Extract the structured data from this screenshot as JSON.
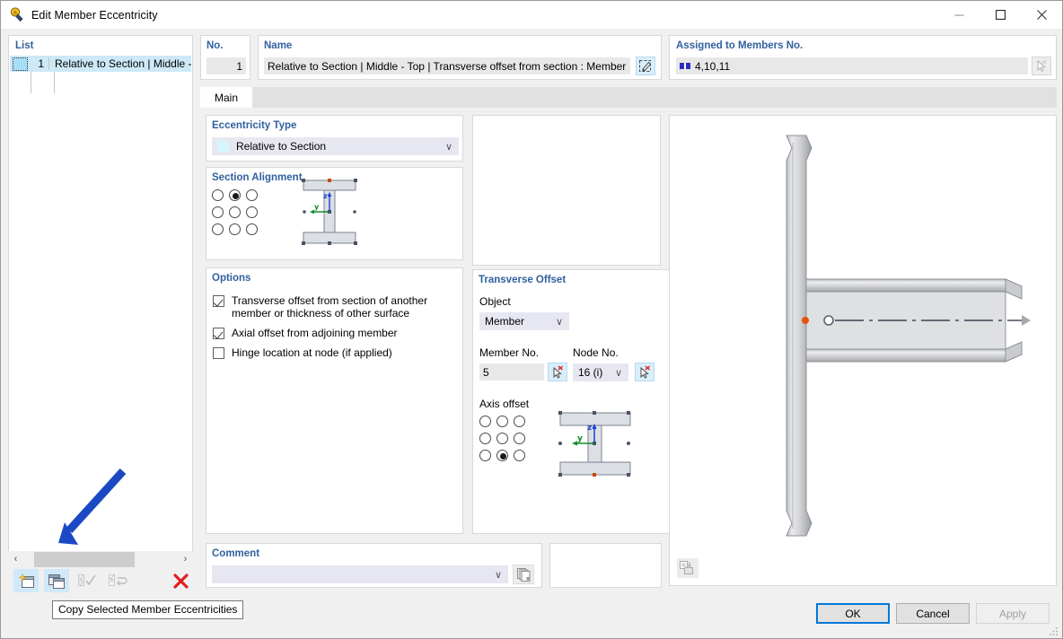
{
  "window": {
    "title": "Edit Member Eccentricity",
    "icon": "member-eccentricity-icon",
    "minimize": "—",
    "maximize": "☐",
    "close": "✕"
  },
  "list": {
    "label": "List",
    "rows": [
      {
        "no": "1",
        "label": "Relative to Section | Middle - To"
      }
    ],
    "scroll_left": "‹",
    "scroll_right": "›",
    "toolbar": [
      {
        "name": "new-member-eccentricity-button",
        "icon": "new-window-icon",
        "state": "enabled"
      },
      {
        "name": "copy-selected-member-eccentricities-button",
        "icon": "copy-window-icon",
        "state": "enabled"
      },
      {
        "name": "apply-selection-button",
        "icon": "checklist-check-icon",
        "state": "disabled"
      },
      {
        "name": "invert-selection-button",
        "icon": "checklist-swap-icon",
        "state": "disabled"
      },
      {
        "name": "delete-button",
        "icon": "red-x-icon",
        "state": "enabled",
        "glyph": "✕"
      }
    ]
  },
  "tooltip": {
    "text": "Copy Selected Member Eccentricities"
  },
  "status_strip": [
    {
      "name": "help-button",
      "icon": "question-bubble-icon"
    },
    {
      "name": "units-button",
      "icon": "number-units-icon"
    },
    {
      "name": "color-button",
      "icon": "color-swatch-icon"
    },
    {
      "name": "font-button",
      "icon": "font-label-icon"
    },
    {
      "name": "display-button",
      "icon": "display-icon"
    },
    {
      "name": "report-button",
      "icon": "report-icon"
    },
    {
      "name": "formula-button",
      "icon": "formula-icon"
    }
  ],
  "number": {
    "label": "No.",
    "value": "1"
  },
  "name": {
    "label": "Name",
    "value": "Relative to Section | Middle - Top | Transverse offset from section : Member No",
    "edit_icon": "edit-pencil-icon"
  },
  "assigned": {
    "label": "Assigned to Members No.",
    "value": "4,10,11",
    "pick_icon": "pick-cursor-icon"
  },
  "tabs": [
    {
      "label": "Main",
      "active": true
    }
  ],
  "eccentricity_type": {
    "label": "Eccentricity Type",
    "value": "Relative to Section",
    "chevron": "∨",
    "options": [
      "Relative to Section"
    ]
  },
  "section_alignment": {
    "label": "Section Alignment",
    "selected_index": 1,
    "cells": 9,
    "diagram": "i-section-alignment-diagram",
    "axis_labels": {
      "z": "z",
      "y": "y"
    }
  },
  "options": {
    "label": "Options",
    "items": [
      {
        "label": "Transverse offset from section of another member or thickness of other surface",
        "checked": true
      },
      {
        "label": "Axial offset from adjoining member",
        "checked": true
      },
      {
        "label": "Hinge location at node (if applied)",
        "checked": false
      }
    ]
  },
  "transverse_offset": {
    "label": "Transverse Offset",
    "object_label": "Object",
    "object_value": "Member",
    "object_options": [
      "Member"
    ],
    "member_label": "Member No.",
    "member_value": "5",
    "node_label": "Node No.",
    "node_value": "16 (i)",
    "node_options": [
      "16 (i)"
    ],
    "axis_label": "Axis offset",
    "axis_selected_index": 7,
    "axis_cells": 9,
    "diagram": "i-section-axis-offset-diagram",
    "axis_labels": {
      "z": "z",
      "y": "y"
    },
    "pick_icon": "pick-cursor-icon",
    "chevron": "∨"
  },
  "preview": {
    "name": "member-eccentricity-preview",
    "icon": "preview-settings-icon"
  },
  "comment": {
    "label": "Comment",
    "value": "",
    "chevron": "∨",
    "copy_icon": "copy-pages-icon"
  },
  "buttons": {
    "ok": "OK",
    "cancel": "Cancel",
    "apply": "Apply"
  },
  "annotation": {
    "arrow": "blue-arrow-pointer",
    "color": "#1b49c4"
  }
}
